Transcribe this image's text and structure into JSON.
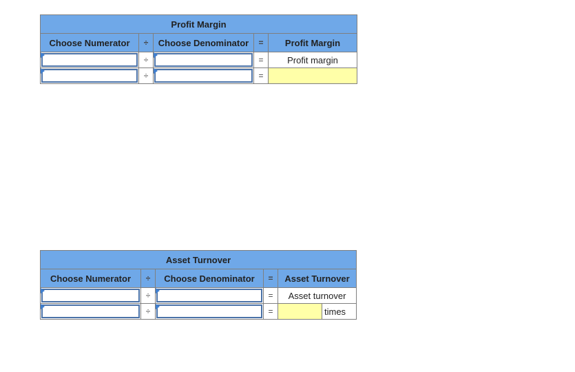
{
  "profit_margin_table": {
    "title": "Profit Margin",
    "headers": {
      "numerator": "Choose Numerator",
      "divide": "÷",
      "denominator": "Choose Denominator",
      "equals": "=",
      "result": "Profit Margin"
    },
    "rows": [
      {
        "numerator": "",
        "divide": "÷",
        "denominator": "",
        "equals": "=",
        "result": "Profit margin"
      },
      {
        "numerator": "",
        "divide": "÷",
        "denominator": "",
        "equals": "=",
        "result": ""
      }
    ]
  },
  "asset_turnover_table": {
    "title": "Asset Turnover",
    "headers": {
      "numerator": "Choose Numerator",
      "divide": "÷",
      "denominator": "Choose Denominator",
      "equals": "=",
      "result": "Asset Turnover"
    },
    "rows": [
      {
        "numerator": "",
        "divide": "÷",
        "denominator": "",
        "equals": "=",
        "result": "Asset turnover"
      },
      {
        "numerator": "",
        "divide": "÷",
        "denominator": "",
        "equals": "=",
        "result": "",
        "unit": "times"
      }
    ]
  },
  "colors": {
    "header_bg": "#6fa8e8",
    "answer_bg": "#ffffa8",
    "input_border": "#4a72a8"
  }
}
